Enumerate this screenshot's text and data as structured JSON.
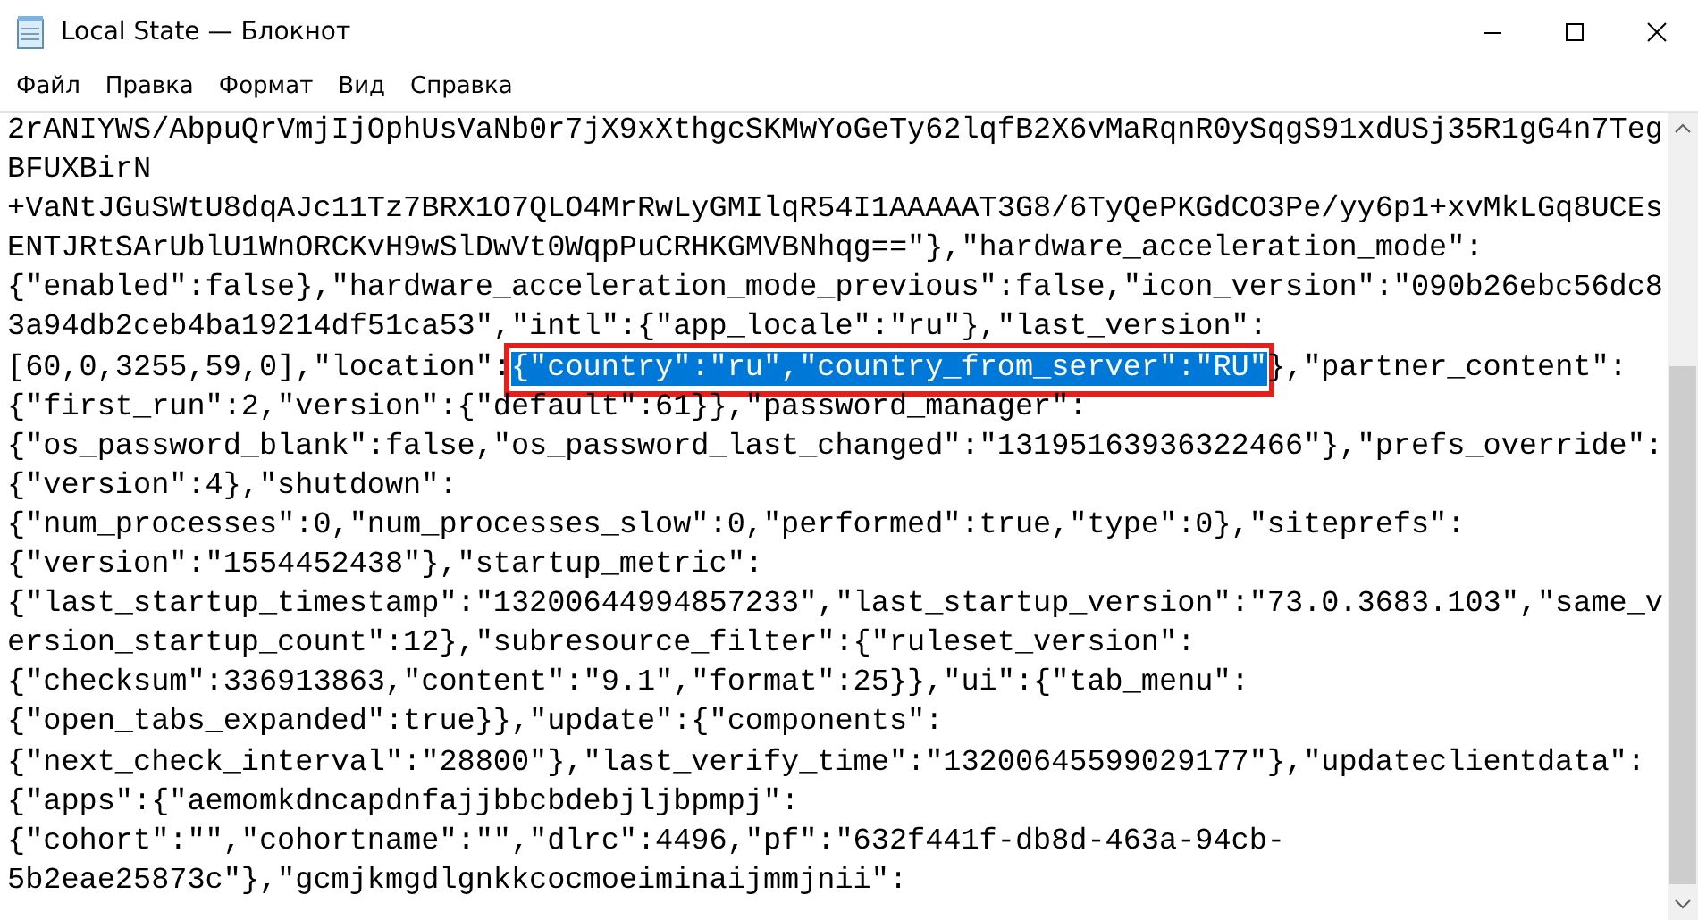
{
  "window": {
    "title": "Local State — Блокнот"
  },
  "menu": [
    {
      "label": "Файл"
    },
    {
      "label": "Правка"
    },
    {
      "label": "Формат"
    },
    {
      "label": "Вид"
    },
    {
      "label": "Справка"
    }
  ],
  "editor": {
    "lines": [
      {
        "kind": "plain",
        "text": "2rANIYWS/AbpuQrVmjIjOphUsVaNb0r7jX9xXthgcSKMwYoGeTy62lqfB2X6vMaRqnR0ySqgS91xdUSj35R1gG4n7Teg"
      },
      {
        "kind": "plain",
        "text": "BFUXBirN"
      },
      {
        "kind": "plain",
        "text": "+VaNtJGuSWtU8dqAJc11Tz7BRX1O7QLO4MrRwLyGMIlqR54I1AAAAAT3G8/6TyQePKGdCO3Pe/yy6p1+xvMkLGq8UCEs"
      },
      {
        "kind": "plain",
        "text": "ENTJRtSArUblU1WnORCKvH9wSlDwVt0WqpPuCRHKGMVBNhqg==\"},\"hardware_acceleration_mode\":"
      },
      {
        "kind": "plain",
        "text": "{\"enabled\":false},\"hardware_acceleration_mode_previous\":false,\"icon_version\":\"090b26ebc56dc8"
      },
      {
        "kind": "plain",
        "text": "3a94db2ceb4ba19214df51ca53\",\"intl\":{\"app_locale\":\"ru\"},\"last_version\":"
      },
      {
        "kind": "selection",
        "before": "[60,0,3255,59,0],\"location\":",
        "selected": "{\"country\":\"ru\",\"country_from_server\":\"RU\"",
        "after": "},\"partner_content\":",
        "highlighted": true
      },
      {
        "kind": "plain",
        "text": "{\"first_run\":2,\"version\":{\"default\":61}},\"password_manager\":"
      },
      {
        "kind": "plain",
        "text": "{\"os_password_blank\":false,\"os_password_last_changed\":\"13195163936322466\"},\"prefs_override\":"
      },
      {
        "kind": "plain",
        "text": "{\"version\":4},\"shutdown\":"
      },
      {
        "kind": "plain",
        "text": "{\"num_processes\":0,\"num_processes_slow\":0,\"performed\":true,\"type\":0},\"siteprefs\":"
      },
      {
        "kind": "plain",
        "text": "{\"version\":\"1554452438\"},\"startup_metric\":"
      },
      {
        "kind": "plain",
        "text": "{\"last_startup_timestamp\":\"13200644994857233\",\"last_startup_version\":\"73.0.3683.103\",\"same_v"
      },
      {
        "kind": "plain",
        "text": "ersion_startup_count\":12},\"subresource_filter\":{\"ruleset_version\":"
      },
      {
        "kind": "plain",
        "text": "{\"checksum\":336913863,\"content\":\"9.1\",\"format\":25}},\"ui\":{\"tab_menu\":"
      },
      {
        "kind": "plain",
        "text": "{\"open_tabs_expanded\":true}},\"update\":{\"components\":"
      },
      {
        "kind": "plain",
        "text": "{\"next_check_interval\":\"28800\"},\"last_verify_time\":\"13200645599029177\"},\"updateclientdata\":"
      },
      {
        "kind": "plain",
        "text": "{\"apps\":{\"aemomkdncapdnfajjbbcbdebjljbpmpj\":"
      },
      {
        "kind": "plain",
        "text": "{\"cohort\":\"\",\"cohortname\":\"\",\"dlrc\":4496,\"pf\":\"632f441f-db8d-463a-94cb-"
      },
      {
        "kind": "plain",
        "text": "5b2eae25873c\"},\"gcmjkmgdlgnkkcocmoeiminaijmmjnii\":"
      }
    ]
  }
}
